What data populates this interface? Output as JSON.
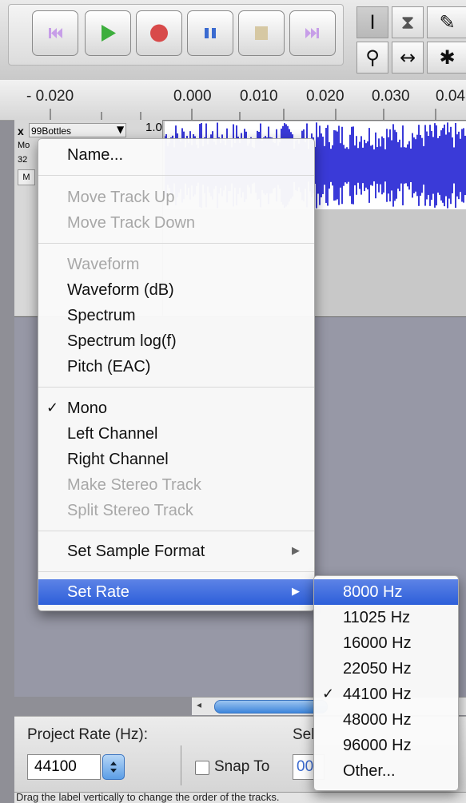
{
  "toolbar": {
    "transport": [
      {
        "name": "skip-to-start-button",
        "icon": "skip-start-icon"
      },
      {
        "name": "play-button",
        "icon": "play-icon"
      },
      {
        "name": "record-button",
        "icon": "record-icon"
      },
      {
        "name": "pause-button",
        "icon": "pause-icon"
      },
      {
        "name": "stop-button",
        "icon": "stop-icon"
      },
      {
        "name": "skip-to-end-button",
        "icon": "skip-end-icon"
      }
    ],
    "tool_glyphs": {
      "select": "I",
      "envelope": "⧗",
      "draw": "✎",
      "zoom": "⚲",
      "timeshift": "↔",
      "multi": "✱"
    }
  },
  "ruler": {
    "ticks": [
      "- 0.020",
      "0.000",
      "0.010",
      "0.020",
      "0.030",
      "0.04"
    ]
  },
  "track": {
    "close": "x",
    "name": "99Bottles",
    "dropdown_glyph": "▼",
    "scale_label": "1.0",
    "info_lines": [
      "Mo",
      "32"
    ],
    "mute_letter": "M"
  },
  "menu": {
    "name": "Name...",
    "move_up": "Move Track Up",
    "move_down": "Move Track Down",
    "waveform": "Waveform",
    "waveform_db": "Waveform (dB)",
    "spectrum": "Spectrum",
    "spectrum_log": "Spectrum log(f)",
    "pitch": "Pitch (EAC)",
    "mono": "Mono",
    "left_channel": "Left Channel",
    "right_channel": "Right Channel",
    "make_stereo": "Make Stereo Track",
    "split_stereo": "Split Stereo Track",
    "sample_format": "Set Sample Format",
    "set_rate": "Set Rate",
    "check_glyph": "✓",
    "submenu_glyph": "▶"
  },
  "rate_submenu": {
    "options": [
      "8000 Hz",
      "11025 Hz",
      "16000 Hz",
      "22050 Hz",
      "44100 Hz",
      "48000 Hz",
      "96000 Hz",
      "Other..."
    ],
    "highlighted": "8000 Hz",
    "checked": "44100 Hz"
  },
  "bottom": {
    "project_rate_label": "Project Rate (Hz):",
    "project_rate_value": "44100",
    "snap_to_label": "Snap To",
    "selection_partial": "Sel",
    "field_partial": "00"
  },
  "status": {
    "text": "Drag the label vertically to change the order of the tracks."
  },
  "colors": {
    "accent": "#2d5fd9",
    "waveform": "#3a3ad8",
    "play": "#3dae3d",
    "record": "#d84a4a",
    "pause": "#3a6ad0",
    "skip": "#c79ee8",
    "stop": "#d6c8a3"
  }
}
